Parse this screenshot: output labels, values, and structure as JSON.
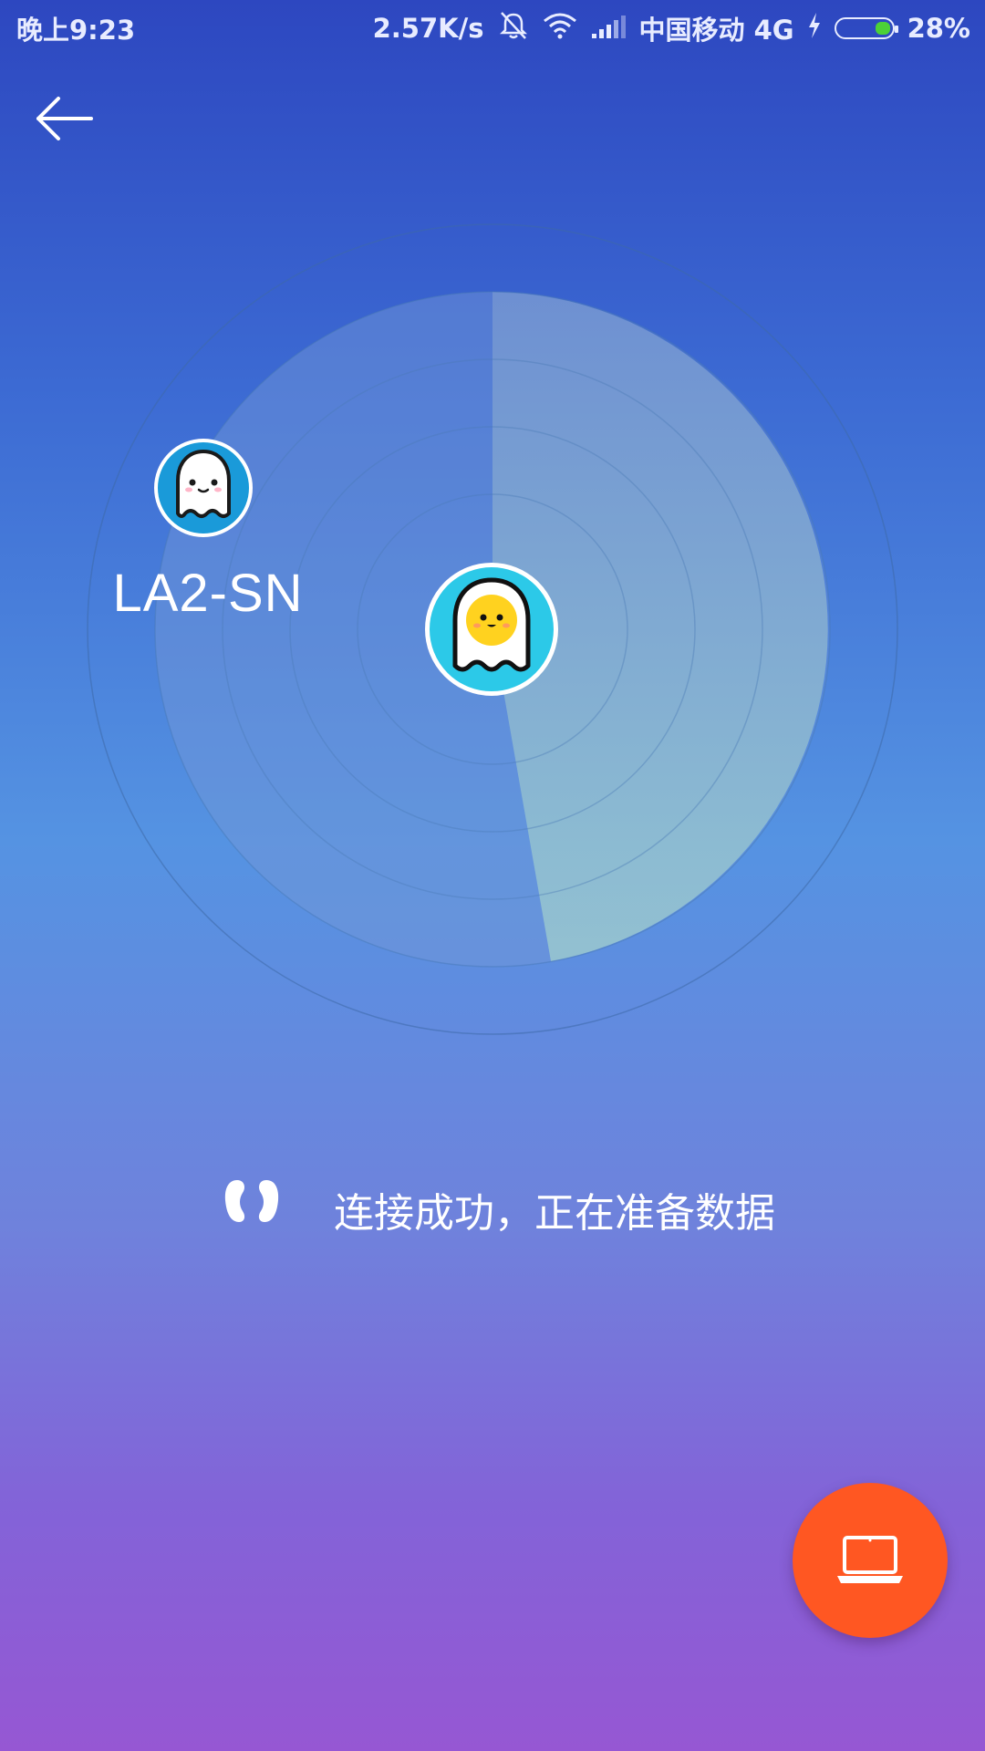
{
  "status_bar": {
    "time": "晚上9:23",
    "speed": "2.57K/s",
    "carrier": "中国移动 4G",
    "battery_percent": "28%",
    "battery_level": 0.28,
    "icons": [
      "bell-off-icon",
      "wifi-icon",
      "signal-icon",
      "charging-icon",
      "battery-icon"
    ]
  },
  "header": {
    "back_icon": "arrow-left-icon"
  },
  "radar": {
    "device": {
      "name": "LA2-SN",
      "avatar_icon": "ghost-icon"
    },
    "self": {
      "avatar_icon": "ghost-sun-icon"
    }
  },
  "status": {
    "message": "连接成功，正在准备数据",
    "icon": "quote-icon"
  },
  "fab": {
    "icon": "laptop-icon",
    "color": "#ff5722"
  },
  "colors": {
    "accent": "#ff5722",
    "device_bg": "#1a9ad9",
    "self_bg": "#2cc9e8"
  }
}
